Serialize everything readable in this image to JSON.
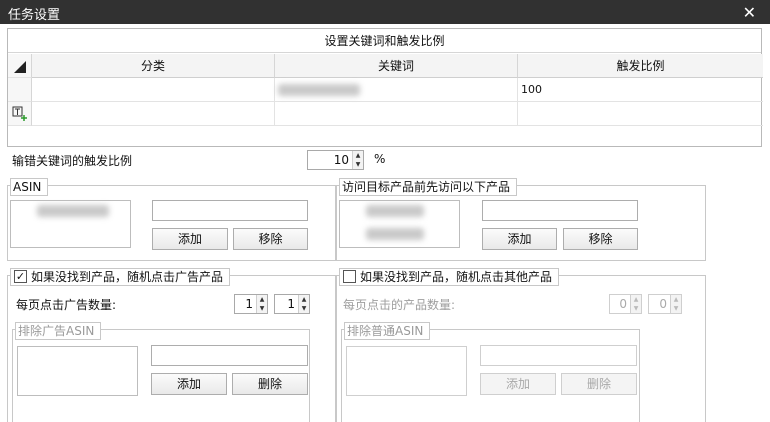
{
  "window": {
    "title": "任务设置",
    "close_glyph": "✕"
  },
  "keyword_grid": {
    "caption": "设置关键词和触发比例",
    "columns": [
      "分类",
      "关键词",
      "触发比例"
    ],
    "rows": [
      {
        "category": "",
        "keyword": "",
        "ratio": "100"
      }
    ]
  },
  "typo_ratio": {
    "label": "输错关键词的触发比例",
    "value": "10",
    "unit": "%"
  },
  "asin_group": {
    "legend": "ASIN",
    "add_label": "添加",
    "remove_label": "移除"
  },
  "visit_group": {
    "legend": "访问目标产品前先访问以下产品",
    "add_label": "添加",
    "remove_label": "移除"
  },
  "ad_group": {
    "checkbox_label": "如果没找到产品，随机点击广告产品",
    "checked": true,
    "count_label": "每页点击广告数量:",
    "min_value": "1",
    "max_value": "1",
    "exclude_legend": "排除广告ASIN",
    "add_label": "添加",
    "delete_label": "删除"
  },
  "other_group": {
    "checkbox_label": "如果没找到产品，随机点击其他产品",
    "checked": false,
    "count_label": "每页点击的产品数量:",
    "min_value": "0",
    "max_value": "0",
    "exclude_legend": "排除普通ASIN",
    "add_label": "添加",
    "delete_label": "删除"
  }
}
